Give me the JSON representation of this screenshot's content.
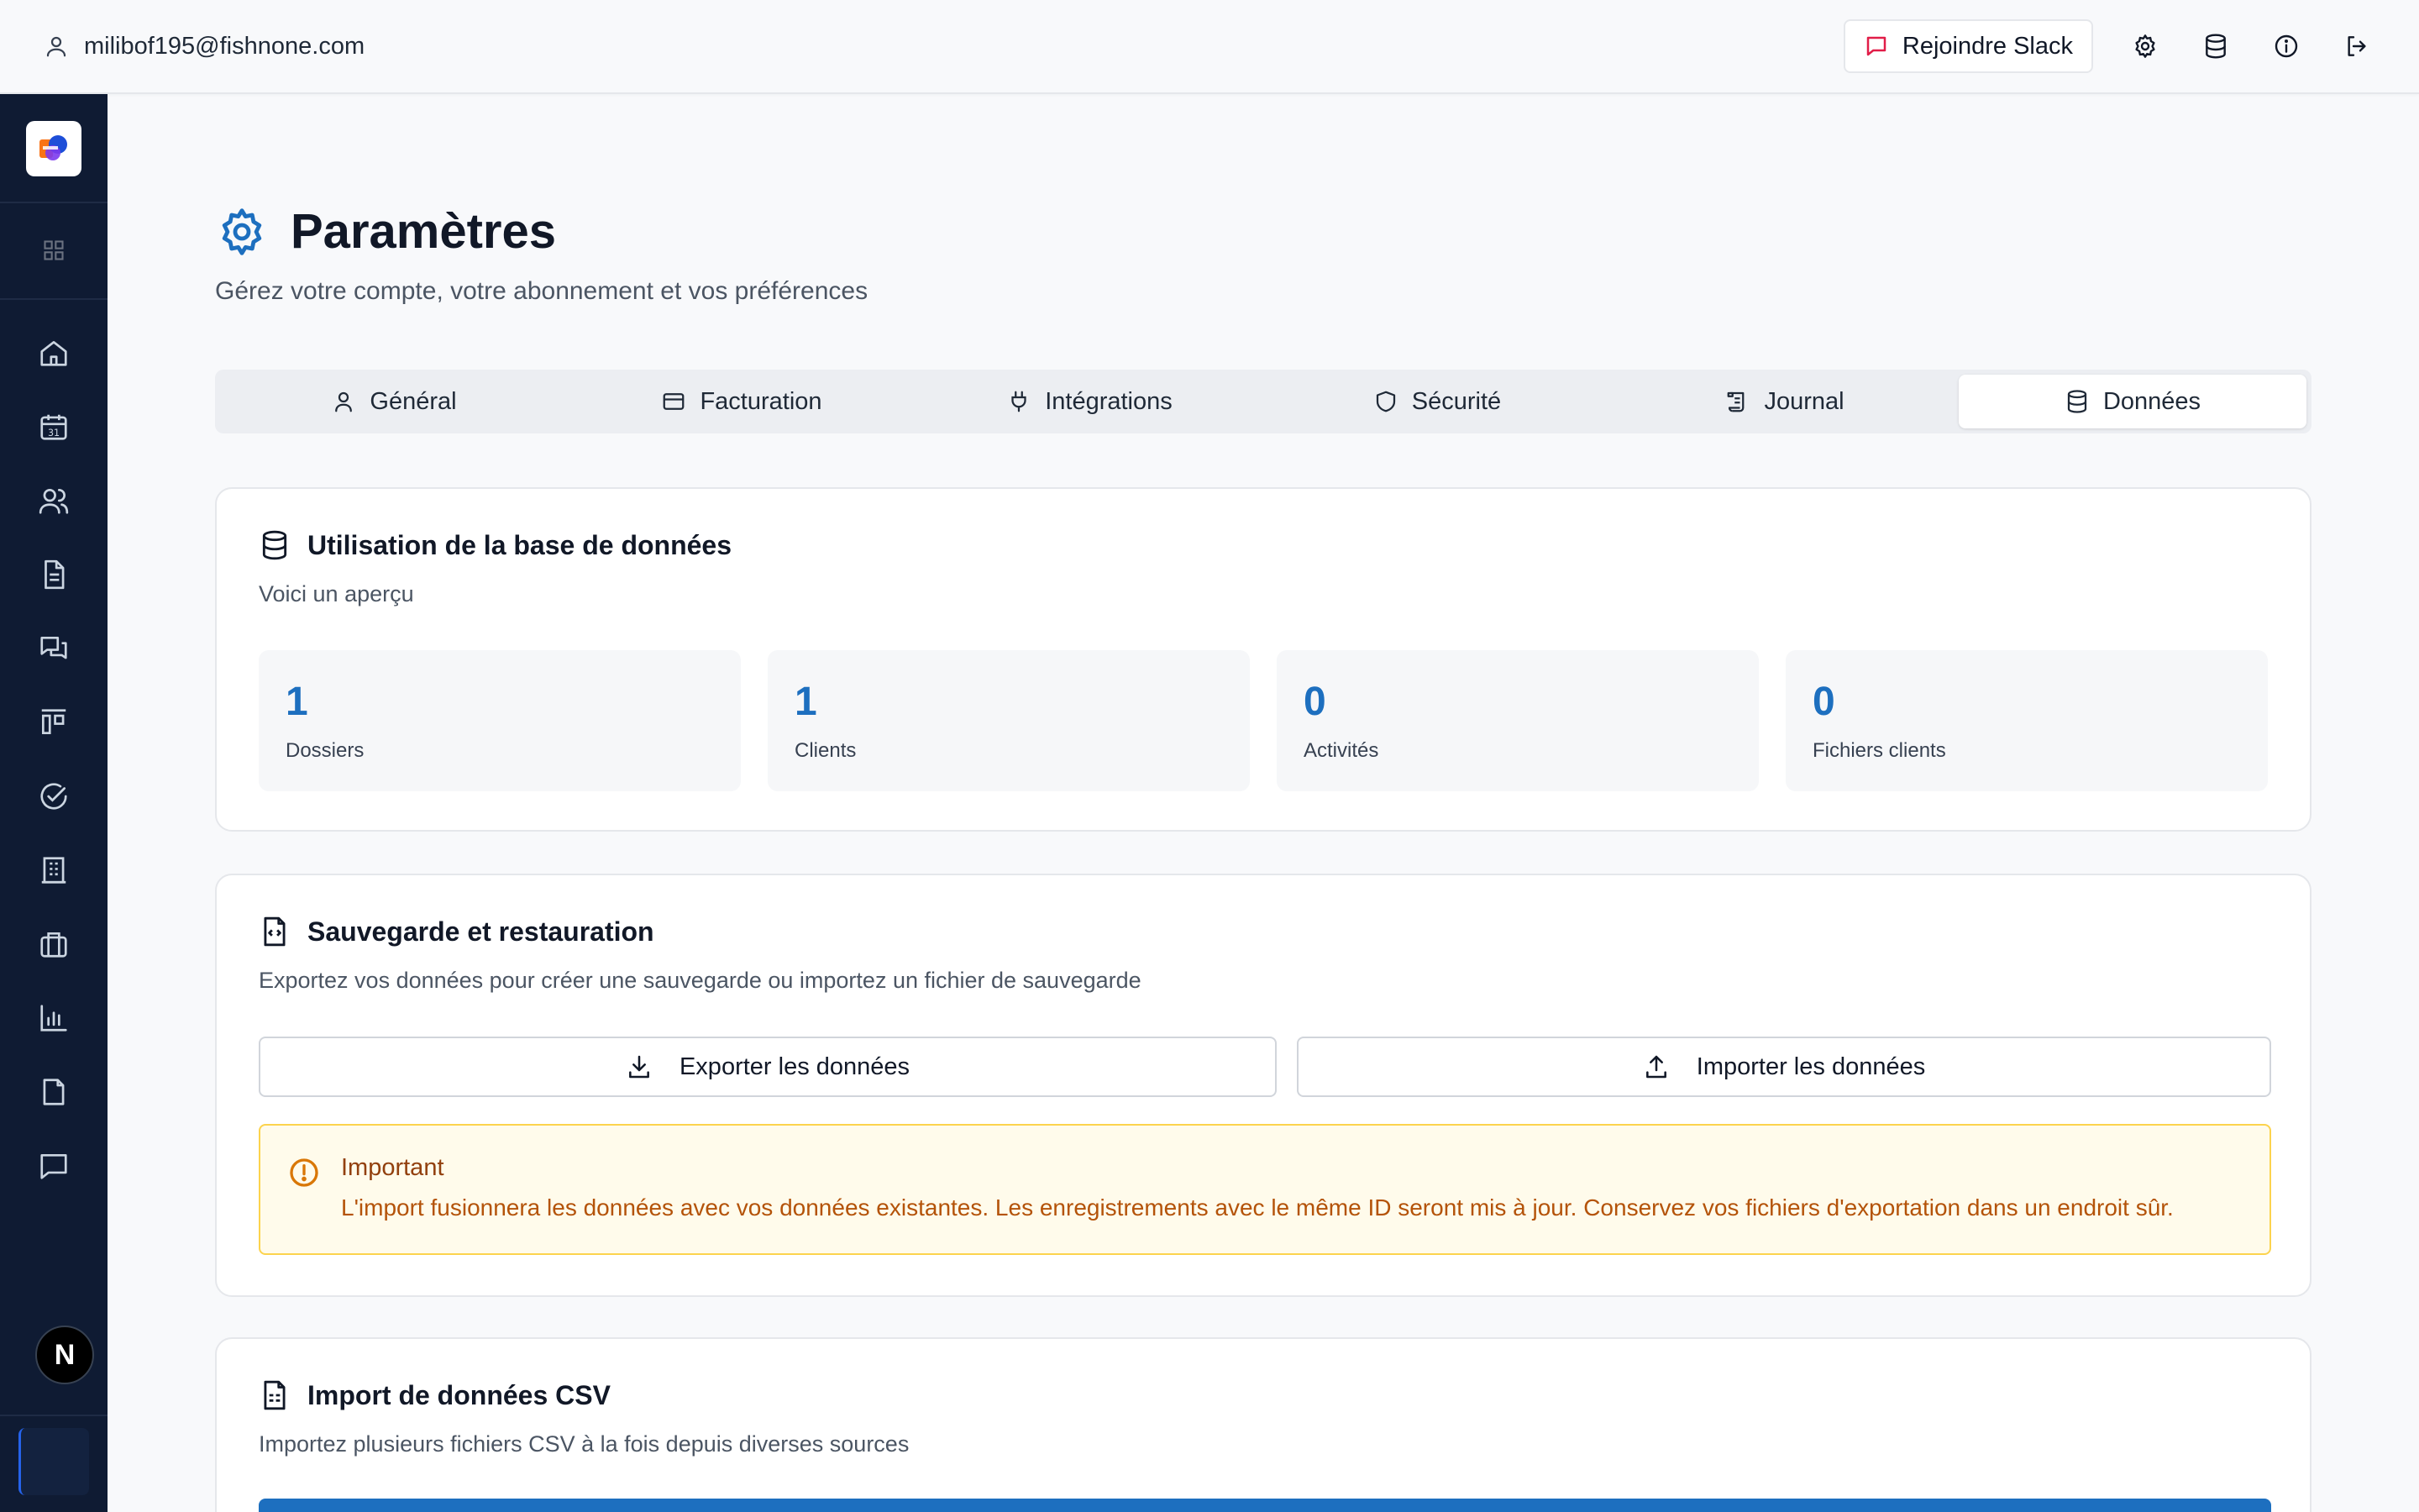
{
  "user": {
    "email": "milibof195@fishnone.com"
  },
  "topbar": {
    "slack_label": "Rejoindre Slack"
  },
  "sidebar": {
    "badge": "N"
  },
  "page": {
    "title": "Paramètres",
    "subtitle": "Gérez votre compte, votre abonnement et vos préférences"
  },
  "tabs": [
    {
      "label": "Général",
      "icon": "user-icon"
    },
    {
      "label": "Facturation",
      "icon": "credit-card-icon"
    },
    {
      "label": "Intégrations",
      "icon": "plug-icon"
    },
    {
      "label": "Sécurité",
      "icon": "shield-icon"
    },
    {
      "label": "Journal",
      "icon": "scroll-icon"
    },
    {
      "label": "Données",
      "icon": "database-icon",
      "active": true
    }
  ],
  "usage": {
    "title": "Utilisation de la base de données",
    "desc": "Voici un aperçu",
    "stats": [
      {
        "value": "1",
        "label": "Dossiers"
      },
      {
        "value": "1",
        "label": "Clients"
      },
      {
        "value": "0",
        "label": "Activités"
      },
      {
        "value": "0",
        "label": "Fichiers clients"
      }
    ]
  },
  "backup": {
    "title": "Sauvegarde et restauration",
    "desc": "Exportez vos données pour créer une sauvegarde ou importez un fichier de sauvegarde",
    "export_label": "Exporter les données",
    "import_label": "Importer les données",
    "alert_title": "Important",
    "alert_text": "L'import fusionnera les données avec vos données existantes. Les enregistrements avec le même ID seront mis à jour. Conservez vos fichiers d'exportation dans un endroit sûr."
  },
  "csv": {
    "title": "Import de données CSV",
    "desc": "Importez plusieurs fichiers CSV à la fois depuis diverses sources"
  },
  "colors": {
    "accent": "#1d6fbf",
    "sidebar": "#0f1b33",
    "warning_bg": "#fffbeb",
    "warning_text": "#b45309",
    "slack_icon": "#e11d48"
  }
}
